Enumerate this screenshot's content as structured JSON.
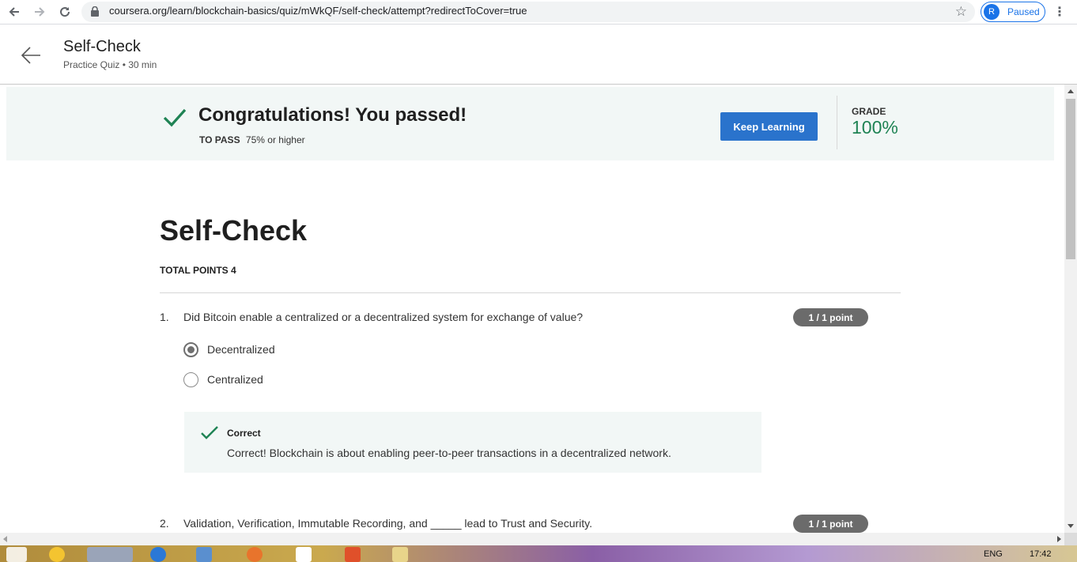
{
  "browser": {
    "url": "coursera.org/learn/blockchain-basics/quiz/mWkQF/self-check/attempt?redirectToCover=true",
    "profile_initial": "R",
    "profile_status": "Paused"
  },
  "header": {
    "title": "Self-Check",
    "subtitle": "Practice Quiz • 30 min"
  },
  "banner": {
    "message": "Congratulations! You passed!",
    "to_pass_label": "TO PASS",
    "to_pass_value": "75% or higher",
    "keep_learning_label": "Keep Learning",
    "grade_label": "GRADE",
    "grade_value": "100%"
  },
  "quiz": {
    "title": "Self-Check",
    "total_points": "TOTAL POINTS 4",
    "questions": [
      {
        "number": "1.",
        "text": "Did Bitcoin enable a centralized or a decentralized system for exchange of value?",
        "points": "1 / 1 point",
        "options": [
          {
            "label": "Decentralized",
            "selected": true
          },
          {
            "label": "Centralized",
            "selected": false
          }
        ],
        "feedback_title": "Correct",
        "feedback_text": "Correct! Blockchain is about enabling peer-to-peer transactions in a decentralized network."
      },
      {
        "number": "2.",
        "text": "Validation, Verification, Immutable Recording, and _____ lead to Trust and Security.",
        "points": "1 / 1 point"
      }
    ]
  },
  "taskbar": {
    "language": "ENG",
    "time": "17:42"
  },
  "colors": {
    "accent_blue": "#2a73cc",
    "success_green": "#1f8354",
    "banner_bg": "#f2f7f6"
  }
}
